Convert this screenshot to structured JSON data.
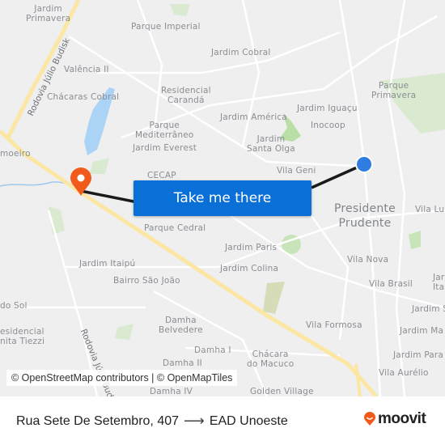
{
  "map": {
    "labels": {
      "jardim_primavera": "Jardim\nPrimavera",
      "parque_imperial": "Parque Imperial",
      "jardim_cobral": "Jardim Cobral",
      "valencia_ii": "Valência II",
      "chacaras_cobral": "Chácaras Cobral",
      "residencial_caranda": "Residencial\nCarandá",
      "parque_mediterraneo": "Parque\nMediterrâneo",
      "jardim_everest": "Jardim Everest",
      "jardim_america": "Jardim América",
      "jardim_iguacu": "Jardim Iguaçu",
      "inocoop": "Inocoop",
      "jardim_santa_olga": "Jardim\nSanta Olga",
      "parque_primavera": "Parque\nPrimavera",
      "vila_geni": "Vila Geni",
      "cecap": "CECAP",
      "limoeiro": "moeiro",
      "presidente_prudente": "Presidente\nPrudente",
      "vila_lu": "Vila Lu",
      "parque_cedral": "Parque Cedral",
      "jardim_paris": "Jardim Paris",
      "jardim_colina": "Jardim Colina",
      "vila_nova": "Vila Nova",
      "vila_brasil": "Vila Brasil",
      "jardim_ita": "Jar\nIta",
      "jardim_itaipu": "Jardim Itaipú",
      "bairro_sao_joao": "Bairro São João",
      "do_sol": "do Sol",
      "residencial_anita_tiezzi": "esidencial\nnita Tiezzi",
      "damha_belvedere": "Damha\nBelvedere",
      "damha_i": "Damha I",
      "damha_ii": "Damha II",
      "vila_formosa": "Vila Formosa",
      "chacara_do_macuco": "Chácara\ndo Macuco",
      "jardim_s": "Jardim S",
      "jardim_ma": "Jardim Ma",
      "jardim_para": "Jardim Para",
      "vila_aurelio": "Vila Aurélio",
      "golden_village": "Golden Village",
      "damha_iv": "Damha IV"
    },
    "road_labels": {
      "rodovia_julio_budisk_north": "Rodovia Júlio Budisk",
      "rodovia_julio_budisk_south": "Rodovia Júlio Bud"
    },
    "colors": {
      "background": "#efefef",
      "highway": "#fbe7a3",
      "water": "#aad3f5",
      "park": "#cfe5c0",
      "route": "#1a1a1a",
      "origin_marker": "#2f7de1",
      "destination_marker": "#f05a1a"
    },
    "origin_marker": "blue-dot-icon",
    "destination_marker": "map-pin-icon"
  },
  "cta": {
    "label": "Take me there",
    "color": "#0a6fd6"
  },
  "attribution": "© OpenStreetMap contributors | © OpenMapTiles",
  "footer": {
    "origin": "Rua Sete De Setembro, 407",
    "arrow": "⟶",
    "destination": "EAD Unoeste",
    "brand": "moovit",
    "brand_color": "#f05a1a"
  }
}
